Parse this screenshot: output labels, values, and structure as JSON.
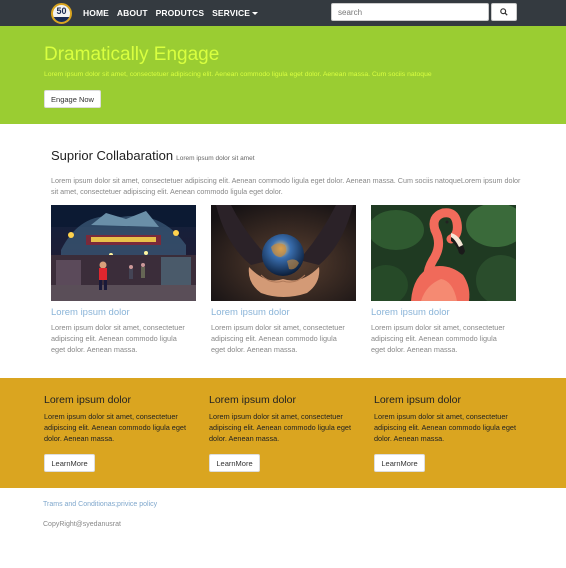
{
  "navbar": {
    "logo_text": "50",
    "links": [
      {
        "label": "HOME"
      },
      {
        "label": "ABOUT"
      },
      {
        "label": "PRODUTCS"
      },
      {
        "label": "SERVICE"
      }
    ],
    "search_placeholder": "search",
    "search_value": "",
    "search_icon": "search-icon"
  },
  "hero": {
    "title": "Dramatically Engage",
    "subtitle": "Lorem ipsum dolor sit amet, consectetuer adipiscing elit. Aenean commodo ligula eget dolor. Aenean massa. Cum sociis natoque",
    "button_label": "Engage Now",
    "background_color": "#9acd32",
    "text_color": "#d9ff3f"
  },
  "section": {
    "title": "Suprior Collabaration",
    "title_sub": "Lorem ipsum dolor sit amet",
    "paragraph": "Lorem ipsum dolor sit amet, consectetuer adipiscing elit. Aenean commodo ligula eget dolor. Aenean massa. Cum sociis natoqueLorem ipsum dolor sit amet, consectetuer adipiscing elit. Aenean commodo ligula eget dolor.",
    "cards": [
      {
        "image": "amusement-park-photo",
        "title": "Lorem ipsum dolor",
        "text": "Lorem ipsum dolor sit amet, consectetuer adipiscing elit. Aenean commodo ligula eget dolor. Aenean massa."
      },
      {
        "image": "earth-in-hands-photo",
        "title": "Lorem ipsum dolor",
        "text": "Lorem ipsum dolor sit amet, consectetuer adipiscing elit. Aenean commodo ligula eget dolor. Aenean massa."
      },
      {
        "image": "flamingo-photo",
        "title": "Lorem ipsum dolor",
        "text": "Lorem ipsum dolor sit amet, consectetuer adipiscing elit. Aenean commodo ligula eget dolor. Aenean massa."
      }
    ]
  },
  "features": {
    "background_color": "#daa520",
    "items": [
      {
        "title": "Lorem ipsum dolor",
        "text": "Lorem ipsum dolor sit amet, consectetuer adipiscing elit. Aenean commodo ligula eget dolor. Aenean massa.",
        "button_label": "LearnMore"
      },
      {
        "title": "Lorem ipsum dolor",
        "text": "Lorem ipsum dolor sit amet, consectetuer adipiscing elit. Aenean commodo ligula eget dolor. Aenean massa.",
        "button_label": "LearnMore"
      },
      {
        "title": "Lorem ipsum dolor",
        "text": "Lorem ipsum dolor sit amet, consectetuer adipiscing elit. Aenean commodo ligula eget dolor. Aenean massa.",
        "button_label": "LearnMore"
      }
    ]
  },
  "footer": {
    "link_label": "Trams and Conditionas;privice policy",
    "copyright": "CopyRight@syedanusrat"
  }
}
